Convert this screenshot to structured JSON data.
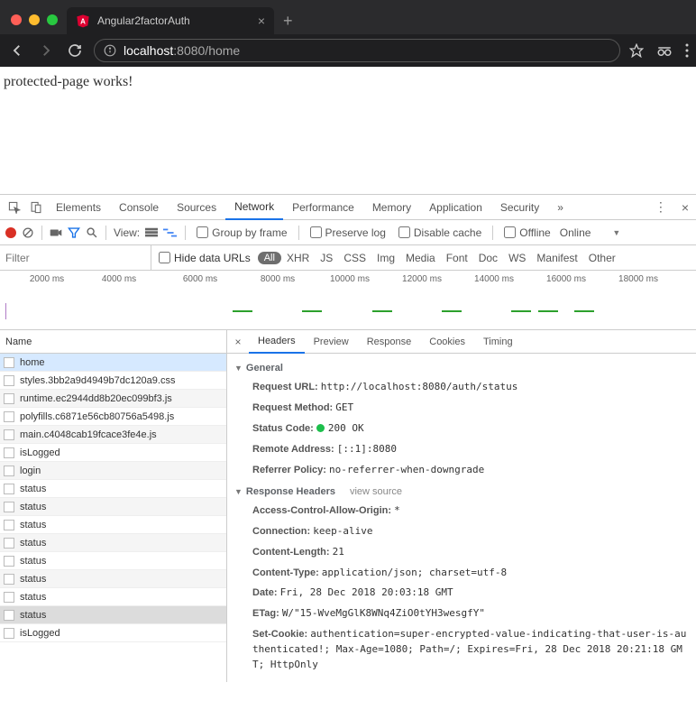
{
  "browser": {
    "tab_title": "Angular2factorAuth",
    "url_scheme_host": "localhost",
    "url_port_path": ":8080/home"
  },
  "page": {
    "content": "protected-page works!"
  },
  "devtools": {
    "tabs": [
      "Elements",
      "Console",
      "Sources",
      "Network",
      "Performance",
      "Memory",
      "Application",
      "Security"
    ],
    "active_tab": "Network",
    "view_label": "View:",
    "group_by_frame": "Group by frame",
    "preserve_log": "Preserve log",
    "disable_cache": "Disable cache",
    "offline": "Offline",
    "online": "Online",
    "filter_placeholder": "Filter",
    "hide_data_urls": "Hide data URLs",
    "type_all": "All",
    "types": [
      "XHR",
      "JS",
      "CSS",
      "Img",
      "Media",
      "Font",
      "Doc",
      "WS",
      "Manifest",
      "Other"
    ],
    "timeline_labels": [
      "2000 ms",
      "4000 ms",
      "6000 ms",
      "8000 ms",
      "10000 ms",
      "12000 ms",
      "14000 ms",
      "16000 ms",
      "18000 ms"
    ],
    "name_col": "Name",
    "requests": [
      {
        "n": "home"
      },
      {
        "n": "styles.3bb2a9d4949b7dc120a9.css"
      },
      {
        "n": "runtime.ec2944dd8b20ec099bf3.js"
      },
      {
        "n": "polyfills.c6871e56cb80756a5498.js"
      },
      {
        "n": "main.c4048cab19fcace3fe4e.js"
      },
      {
        "n": "isLogged"
      },
      {
        "n": "login"
      },
      {
        "n": "status"
      },
      {
        "n": "status"
      },
      {
        "n": "status"
      },
      {
        "n": "status"
      },
      {
        "n": "status"
      },
      {
        "n": "status"
      },
      {
        "n": "status"
      },
      {
        "n": "status"
      },
      {
        "n": "isLogged"
      }
    ],
    "detail_tabs": [
      "Headers",
      "Preview",
      "Response",
      "Cookies",
      "Timing"
    ],
    "detail_active": "Headers",
    "general_label": "General",
    "response_headers_label": "Response Headers",
    "view_source": "view source",
    "general": {
      "request_url_k": "Request URL:",
      "request_url_v": "http://localhost:8080/auth/status",
      "request_method_k": "Request Method:",
      "request_method_v": "GET",
      "status_code_k": "Status Code:",
      "status_code_v": "200 OK",
      "remote_addr_k": "Remote Address:",
      "remote_addr_v": "[::1]:8080",
      "referrer_k": "Referrer Policy:",
      "referrer_v": "no-referrer-when-downgrade"
    },
    "response_headers": {
      "acao_k": "Access-Control-Allow-Origin:",
      "acao_v": "*",
      "conn_k": "Connection:",
      "conn_v": "keep-alive",
      "clen_k": "Content-Length:",
      "clen_v": "21",
      "ctype_k": "Content-Type:",
      "ctype_v": "application/json; charset=utf-8",
      "date_k": "Date:",
      "date_v": "Fri, 28 Dec 2018 20:03:18 GMT",
      "etag_k": "ETag:",
      "etag_v": "W/\"15-WveMgGlK8WNq4ZiO0tYH3wesgfY\"",
      "cookie_k": "Set-Cookie:",
      "cookie_v": "authentication=super-encrypted-value-indicating-that-user-is-authenticated!; Max-Age=1080; Path=/; Expires=Fri, 28 Dec 2018 20:21:18 GMT; HttpOnly"
    }
  }
}
